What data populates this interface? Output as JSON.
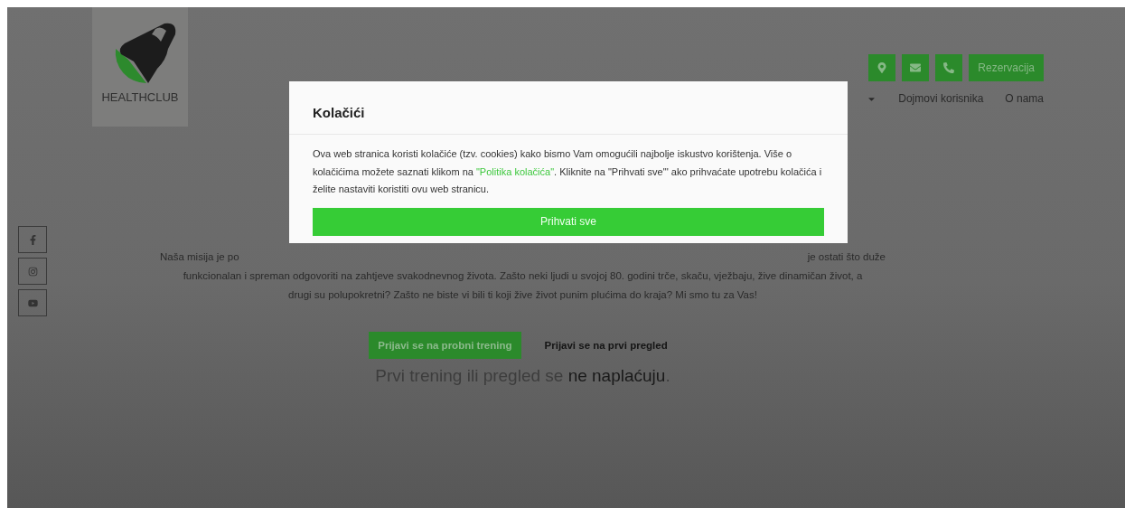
{
  "logo": {
    "text": "HEALTHCLUB"
  },
  "contact_buttons": [
    {
      "kind": "location"
    },
    {
      "kind": "mail"
    },
    {
      "kind": "phone"
    },
    {
      "kind": "text",
      "label": "Rezervacija"
    }
  ],
  "nav": {
    "items": [
      {
        "label": "Dojmovi korisnika"
      },
      {
        "label": "O nama"
      }
    ]
  },
  "social": [
    {
      "kind": "facebook"
    },
    {
      "kind": "instagram"
    },
    {
      "kind": "youtube"
    }
  ],
  "mission": {
    "line_1_left": "Naša misija je po",
    "line_1_right": "je ostati što duže",
    "line_2": "funkcionalan i spreman odgovoriti na zahtjeve svakodnevnog života. Zašto neki ljudi u svojoj 80. godini trče, skaču, vježbaju, žive dinamičan život, a",
    "line_3": "drugi su polupokretni? Zašto ne biste vi bili ti koji žive život punim plućima do kraja? Mi smo tu za Vas!"
  },
  "cta": [
    {
      "label": "Prijavi se na probni trening",
      "kind": "filled"
    },
    {
      "label": "Prijavi se na prvi pregled",
      "kind": "plain"
    }
  ],
  "note": "Prvi trening ili pregled se **ne naplaćuju**.",
  "cookie_modal": {
    "title": "Kolačići",
    "text_before": "Ova web stranica koristi kolačiće (tzv. cookies) kako bismo Vam omogućili najbolje iskustvo korištenja. Više o kolačićima možete saznati klikom na ",
    "link": "\"Politika kolačića\"",
    "text_after": ". Kliknite na \"Prihvati sve\"' ako prihvaćate upotrebu kolačića i želite nastaviti koristiti ovu web stranicu.",
    "button": "Prihvati sve"
  }
}
